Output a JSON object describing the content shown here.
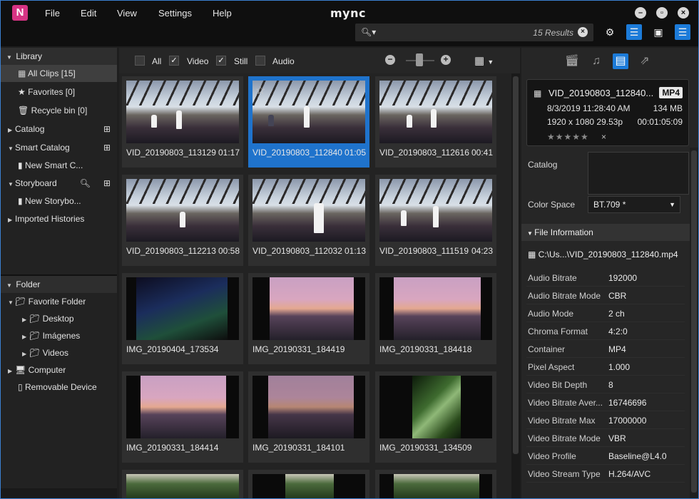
{
  "app": {
    "name": "mync",
    "logo_letter": "N"
  },
  "menu": [
    "File",
    "Edit",
    "View",
    "Settings",
    "Help"
  ],
  "search": {
    "results_text": "15 Results"
  },
  "library": {
    "header": "Library",
    "items": [
      {
        "label": "All Clips [15]",
        "icon": "clips-icon"
      },
      {
        "label": "Favorites [0]",
        "icon": "star-icon"
      },
      {
        "label": "Recycle bin [0]",
        "icon": "trash-icon"
      },
      {
        "label": "Catalog",
        "icon": "catalog-add-icon"
      },
      {
        "label": "Smart Catalog",
        "icon": "catalog-add-icon"
      },
      {
        "label": "New Smart C...",
        "icon": "book-icon"
      },
      {
        "label": "Storyboard",
        "icon": "search-icon"
      },
      {
        "label": "New Storybo...",
        "icon": "book-icon"
      },
      {
        "label": "Imported Histories",
        "icon": ""
      }
    ]
  },
  "folder": {
    "header": "Folder",
    "items": [
      {
        "label": "Favorite Folder"
      },
      {
        "label": "Desktop"
      },
      {
        "label": "Imágenes"
      },
      {
        "label": "Videos"
      },
      {
        "label": "Computer"
      },
      {
        "label": "Removable Device"
      }
    ]
  },
  "filters": {
    "all": "All",
    "video": "Video",
    "still": "Still",
    "audio": "Audio"
  },
  "clips": [
    {
      "name": "VID_20190803_113129",
      "duration": "01:17"
    },
    {
      "name": "VID_20190803_112840",
      "duration": "01:05"
    },
    {
      "name": "VID_20190803_112616",
      "duration": "00:41"
    },
    {
      "name": "VID_20190803_112213",
      "duration": "00:58"
    },
    {
      "name": "VID_20190803_112032",
      "duration": "01:13"
    },
    {
      "name": "VID_20190803_111519",
      "duration": "04:23"
    },
    {
      "name": "IMG_20190404_173534",
      "duration": ""
    },
    {
      "name": "IMG_20190331_184419",
      "duration": ""
    },
    {
      "name": "IMG_20190331_184418",
      "duration": ""
    },
    {
      "name": "IMG_20190331_184414",
      "duration": ""
    },
    {
      "name": "IMG_20190331_184101",
      "duration": ""
    },
    {
      "name": "IMG_20190331_134509",
      "duration": ""
    }
  ],
  "selected_clip": {
    "name": "VID_20190803_112840...",
    "format": "MP4",
    "date": "8/3/2019 11:28:40 AM",
    "size": "134 MB",
    "resolution": "1920 x 1080 29.53p",
    "duration": "00:01:05:09",
    "stars": "★★★★★",
    "unrate": "×"
  },
  "inspector": {
    "catalog_label": "Catalog",
    "colorspace_label": "Color Space",
    "colorspace_value": "BT.709 *",
    "file_info_header": "File Information",
    "file_path": "C:\\Us...\\VID_20190803_112840.mp4",
    "properties": [
      {
        "k": "Audio Bitrate",
        "v": "192000"
      },
      {
        "k": "Audio Bitrate Mode",
        "v": "CBR"
      },
      {
        "k": "Audio Mode",
        "v": "2 ch"
      },
      {
        "k": "Chroma Format",
        "v": "4:2:0"
      },
      {
        "k": "Container",
        "v": "MP4"
      },
      {
        "k": "Pixel Aspect",
        "v": "1.000"
      },
      {
        "k": "Video Bit Depth",
        "v": "8"
      },
      {
        "k": "Video Bitrate Aver...",
        "v": "16746696"
      },
      {
        "k": "Video Bitrate Max",
        "v": "17000000"
      },
      {
        "k": "Video Bitrate Mode",
        "v": "VBR"
      },
      {
        "k": "Video Profile",
        "v": "Baseline@L4.0"
      },
      {
        "k": "Video Stream Type",
        "v": "H.264/AVC"
      }
    ]
  },
  "colors": {
    "accent": "#1c7bd9",
    "logo": "#d63384"
  }
}
